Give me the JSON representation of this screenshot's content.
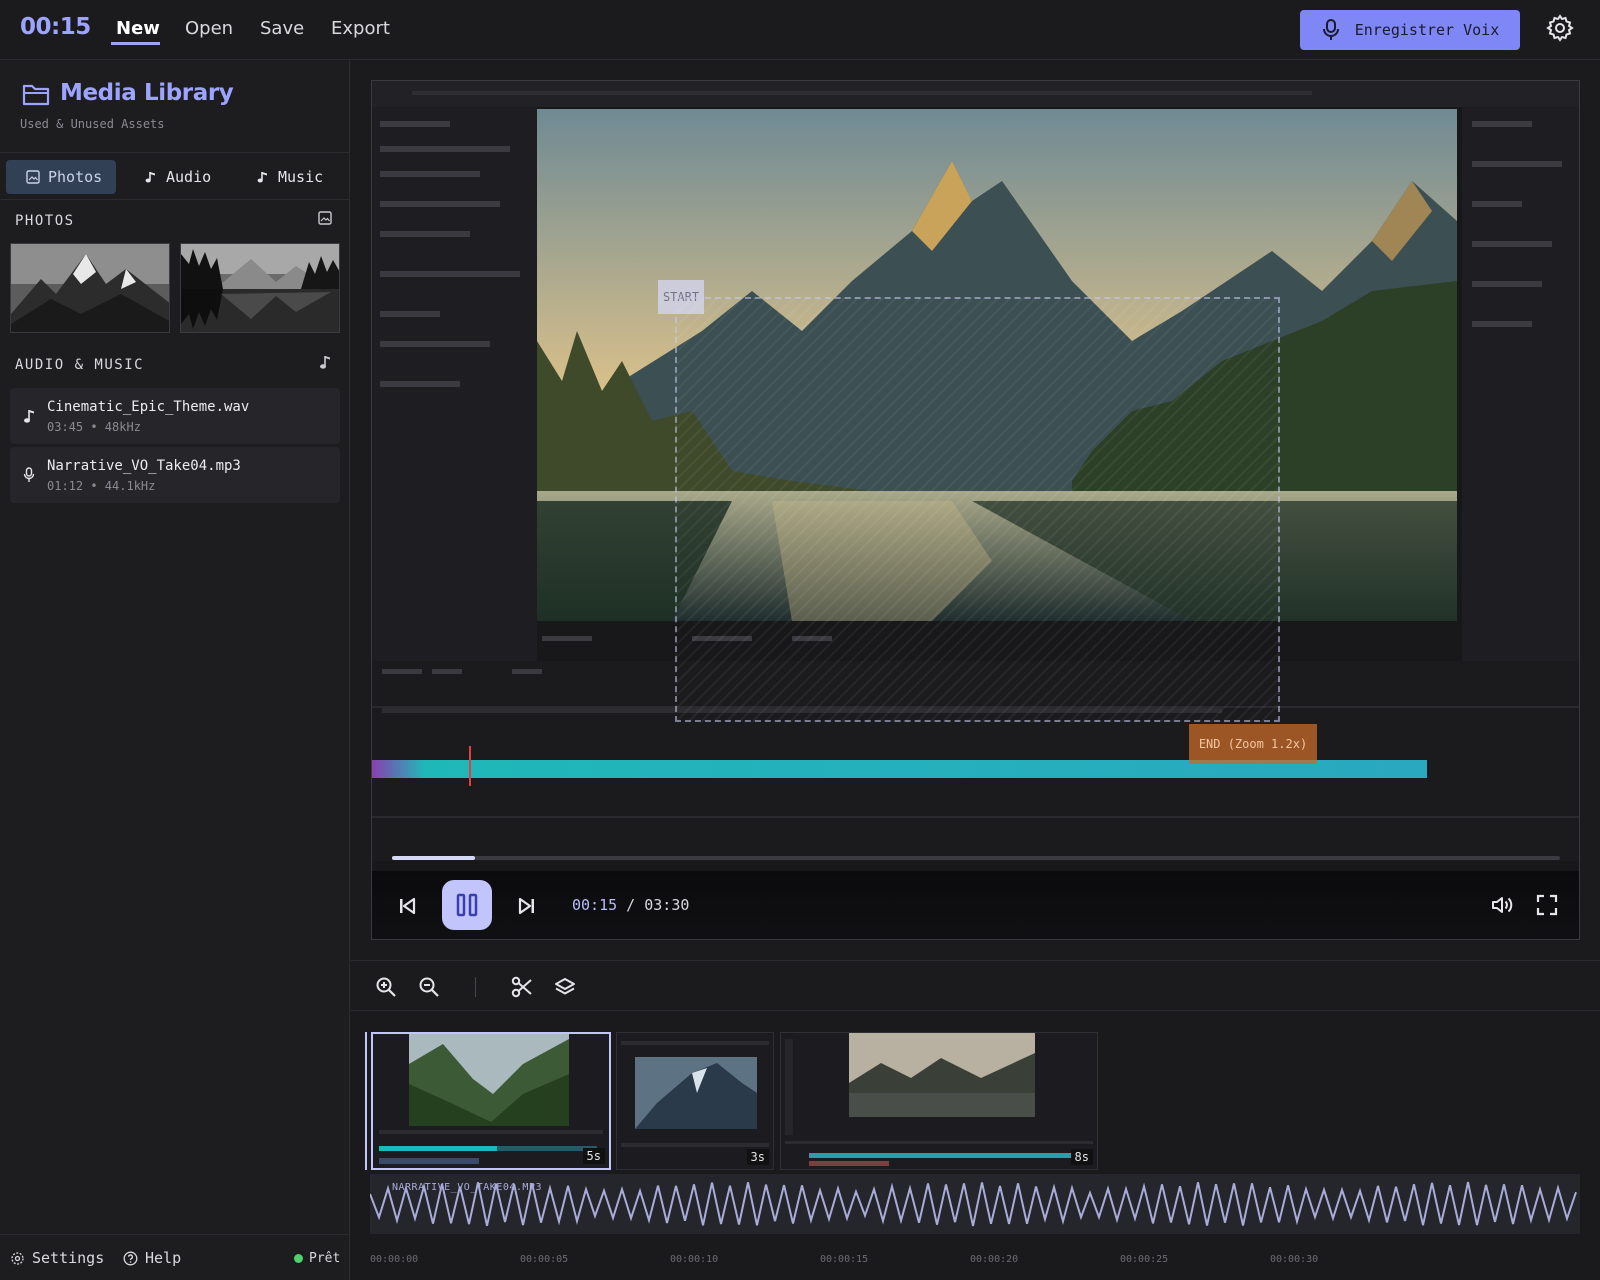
{
  "header": {
    "timecode": "00:15",
    "menu": {
      "new": "New",
      "open": "Open",
      "save": "Save",
      "export": "Export"
    },
    "record_label": "Enregistrer Voix",
    "accent": "#7f86f5"
  },
  "sidebar": {
    "title": "Media Library",
    "subtitle": "Used & Unused Assets",
    "tabs": [
      {
        "label": "Photos",
        "icon": "image-icon",
        "active": true
      },
      {
        "label": "Audio",
        "icon": "music-note-icon"
      },
      {
        "label": "Music",
        "icon": "music-note-icon"
      }
    ],
    "photos_heading": "PHOTOS",
    "audio_heading": "AUDIO & MUSIC",
    "audio_items": [
      {
        "name": "Cinematic_Epic_Theme.wav",
        "meta": "03:45 • 48kHz",
        "icon": "music-note-icon"
      },
      {
        "name": "Narrative_VO_Take04.mp3",
        "meta": "01:12 • 44.1kHz",
        "icon": "microphone-icon"
      }
    ],
    "footer": {
      "settings": "Settings",
      "help": "Help",
      "status": "Prêt",
      "status_color": "#4ed06a"
    }
  },
  "preview": {
    "start_label": "START",
    "end_label": "END (Zoom 1.2x)",
    "current_time": "00:15",
    "separator": " / ",
    "total_time": "03:30",
    "progress_fraction": 0.071
  },
  "timeline": {
    "clips": [
      {
        "duration": "5s",
        "selected": true
      },
      {
        "duration": "3s"
      },
      {
        "duration": "8s"
      }
    ],
    "audio_track_label": "NARRATIVE_VO_TAKE04.MP3",
    "ruler": [
      "00:00:00",
      "00:00:05",
      "00:00:10",
      "00:00:15",
      "00:00:20",
      "00:00:25",
      "00:00:30"
    ]
  }
}
